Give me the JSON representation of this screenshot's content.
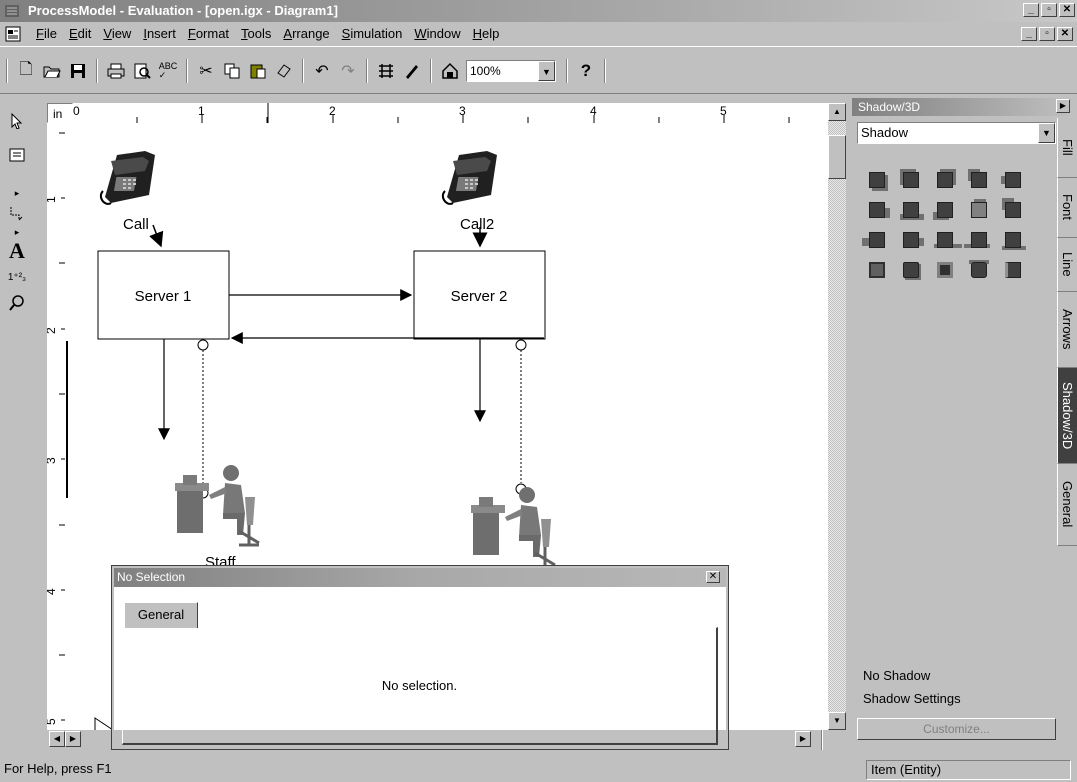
{
  "window": {
    "title": "ProcessModel - Evaluation - [open.igx - Diagram1]"
  },
  "menu": {
    "items": [
      "File",
      "Edit",
      "View",
      "Insert",
      "Format",
      "Tools",
      "Arrange",
      "Simulation",
      "Window",
      "Help"
    ]
  },
  "toolbar": {
    "zoom_value": "100%",
    "help_label": "?"
  },
  "rulers": {
    "unit": "in",
    "h_labels": [
      "0",
      "1",
      "2",
      "3",
      "4",
      "5"
    ],
    "v_labels": [
      "1",
      "2",
      "3",
      "4",
      "5"
    ]
  },
  "diagram": {
    "call1_label": "Call",
    "call2_label": "Call2",
    "server1_label": "Server 1",
    "server2_label": "Server 2",
    "staff_label": "Staff"
  },
  "right_panel": {
    "title": "Shadow/3D",
    "select_value": "Shadow",
    "tabs": [
      "Fill",
      "Font",
      "Line",
      "Arrows",
      "Shadow/3D",
      "General"
    ],
    "active_tab": "Shadow/3D",
    "no_shadow_label": "No Shadow",
    "shadow_settings_label": "Shadow Settings",
    "customize_label": "Customize..."
  },
  "dialog": {
    "title": "No Selection",
    "tab_label": "General",
    "message": "No selection."
  },
  "status": {
    "left": "For Help, press F1",
    "right": "Item (Entity)"
  }
}
